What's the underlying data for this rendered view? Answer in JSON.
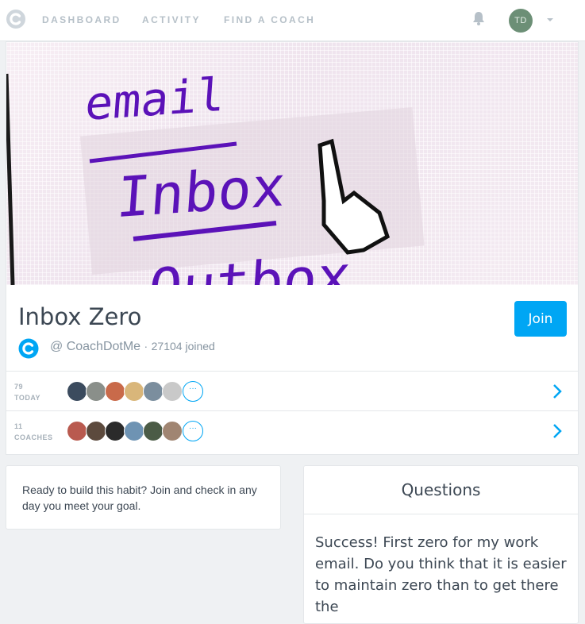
{
  "nav": {
    "links": [
      "DASHBOARD",
      "ACTIVITY",
      "FIND A COACH"
    ],
    "avatar_initials": "TD"
  },
  "hero": {
    "words": [
      "email",
      "Inbox",
      "Outbox"
    ]
  },
  "plan": {
    "title": "Inbox Zero",
    "owner": "@ CoachDotMe",
    "separator": "·",
    "joined": "27104 joined",
    "join_label": "Join"
  },
  "rows": [
    {
      "count": "79",
      "label": "TODAY",
      "more": "···",
      "face_colors": [
        "#3b4b5e",
        "#8a8f8a",
        "#c96a4a",
        "#d9b67a",
        "#7b8e9e",
        "#c9c9c9"
      ]
    },
    {
      "count": "11",
      "label": "COACHES",
      "more": "···",
      "face_colors": [
        "#b95a4f",
        "#5c4a3d",
        "#2b2b2b",
        "#6e93b3",
        "#4b5b46",
        "#a08572"
      ]
    }
  ],
  "ready_text": "Ready to build this habit? Join and check in any day you meet your goal.",
  "questions": {
    "heading": "Questions",
    "body": "Success! First zero for my work email. Do you think that it is easier to maintain zero than to get there the"
  },
  "colors": {
    "accent": "#00a6f4",
    "hero_text": "#5b12b8"
  }
}
